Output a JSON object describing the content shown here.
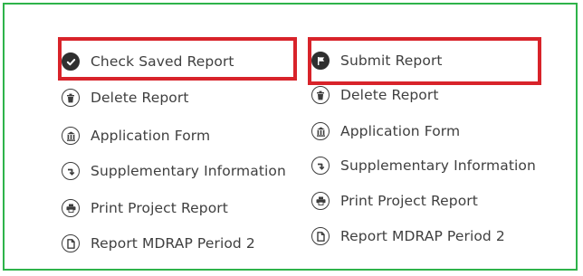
{
  "left_column": {
    "items": [
      {
        "label": "Check Saved Report",
        "icon": "check-circle-icon"
      },
      {
        "label": "Delete Report",
        "icon": "trash-icon"
      },
      {
        "label": "Application Form",
        "icon": "building-icon"
      },
      {
        "label": "Supplementary Information",
        "icon": "arrow-return-icon"
      },
      {
        "label": "Print Project Report",
        "icon": "printer-icon"
      },
      {
        "label": "Report MDRAP Period 2",
        "icon": "document-icon"
      }
    ]
  },
  "right_column": {
    "items": [
      {
        "label": "Submit Report",
        "icon": "flag-icon"
      },
      {
        "label": "Delete Report",
        "icon": "trash-icon"
      },
      {
        "label": "Application Form",
        "icon": "building-icon"
      },
      {
        "label": "Supplementary Information",
        "icon": "arrow-return-icon"
      },
      {
        "label": "Print Project Report",
        "icon": "printer-icon"
      },
      {
        "label": "Report MDRAP Period 2",
        "icon": "document-icon"
      }
    ]
  },
  "colors": {
    "frame_border": "#2eb34a",
    "highlight_border": "#d8232a",
    "text": "#3f3f3f"
  }
}
